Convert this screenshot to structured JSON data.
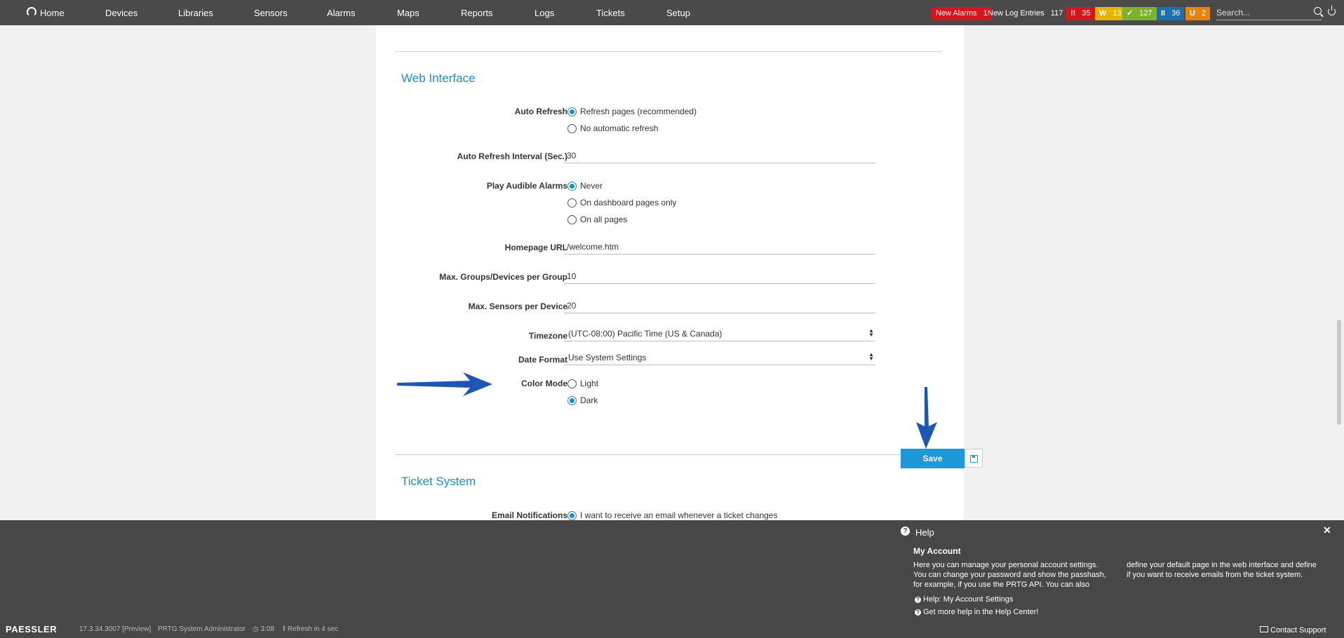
{
  "nav": {
    "items": [
      "Home",
      "Devices",
      "Libraries",
      "Sensors",
      "Alarms",
      "Maps",
      "Reports",
      "Logs",
      "Tickets",
      "Setup"
    ]
  },
  "status": {
    "new_alarms_label": "New Alarms",
    "new_alarms_count": "1",
    "new_log_label": "New Log Entries",
    "new_log_count": "117",
    "down_glyph": "!!",
    "down_count": "35",
    "warning_glyph": "W",
    "warning_count": "13",
    "up_glyph": "✓",
    "up_count": "127",
    "paused_glyph": "II",
    "paused_count": "36",
    "unusual_glyph": "U",
    "unusual_count": "2",
    "colors": {
      "alarm": "#d9141a",
      "down": "#d9141a",
      "warning": "#e8b400",
      "up": "#7bb32e",
      "paused": "#1c6fb5",
      "unusual": "#e8830e"
    }
  },
  "search": {
    "placeholder": "Search..."
  },
  "web_interface": {
    "title": "Web Interface",
    "auto_refresh": {
      "label": "Auto Refresh",
      "options": [
        "Refresh pages (recommended)",
        "No automatic refresh"
      ],
      "selected": 0
    },
    "auto_refresh_interval": {
      "label": "Auto Refresh Interval (Sec.)",
      "value": "30"
    },
    "audible_alarms": {
      "label": "Play Audible Alarms",
      "options": [
        "Never",
        "On dashboard pages only",
        "On all pages"
      ],
      "selected": 0
    },
    "homepage_url": {
      "label": "Homepage URL",
      "value": "/welcome.htm"
    },
    "max_groups": {
      "label": "Max. Groups/Devices per Group",
      "value": "10"
    },
    "max_sensors": {
      "label": "Max. Sensors per Device",
      "value": "20"
    },
    "timezone": {
      "label": "Timezone",
      "value": "(UTC-08:00) Pacific Time (US & Canada)"
    },
    "date_format": {
      "label": "Date Format",
      "value": "Use System Settings"
    },
    "color_mode": {
      "label": "Color Mode",
      "options": [
        "Light",
        "Dark"
      ],
      "selected": 1
    }
  },
  "save_label": "Save",
  "ticket_system": {
    "title": "Ticket System",
    "email_notifications": {
      "label": "Email Notifications",
      "option": "I want to receive an email whenever a ticket changes",
      "selected": true
    }
  },
  "help": {
    "title": "Help",
    "subtitle": "My Account",
    "text_col1_line1": "Here you can manage your personal account settings.",
    "text_col1_line2": "You can change your password and show the passhash,",
    "text_col1_line3": "for example, if you use the PRTG API. You can also",
    "text_col2_line1": "define your default page in the web interface and define",
    "text_col2_line2": "if you want to receive emails from the ticket system.",
    "link1": "Help: My Account Settings",
    "link2": "Get more help in the Help Center!"
  },
  "footer": {
    "logo": "PAESSLER",
    "version": "17.3.34.3007 [Preview]",
    "user": "PRTG System Administrator",
    "time": "3:08",
    "refresh": "Refresh in 4 sec",
    "contact": "Contact Support"
  }
}
